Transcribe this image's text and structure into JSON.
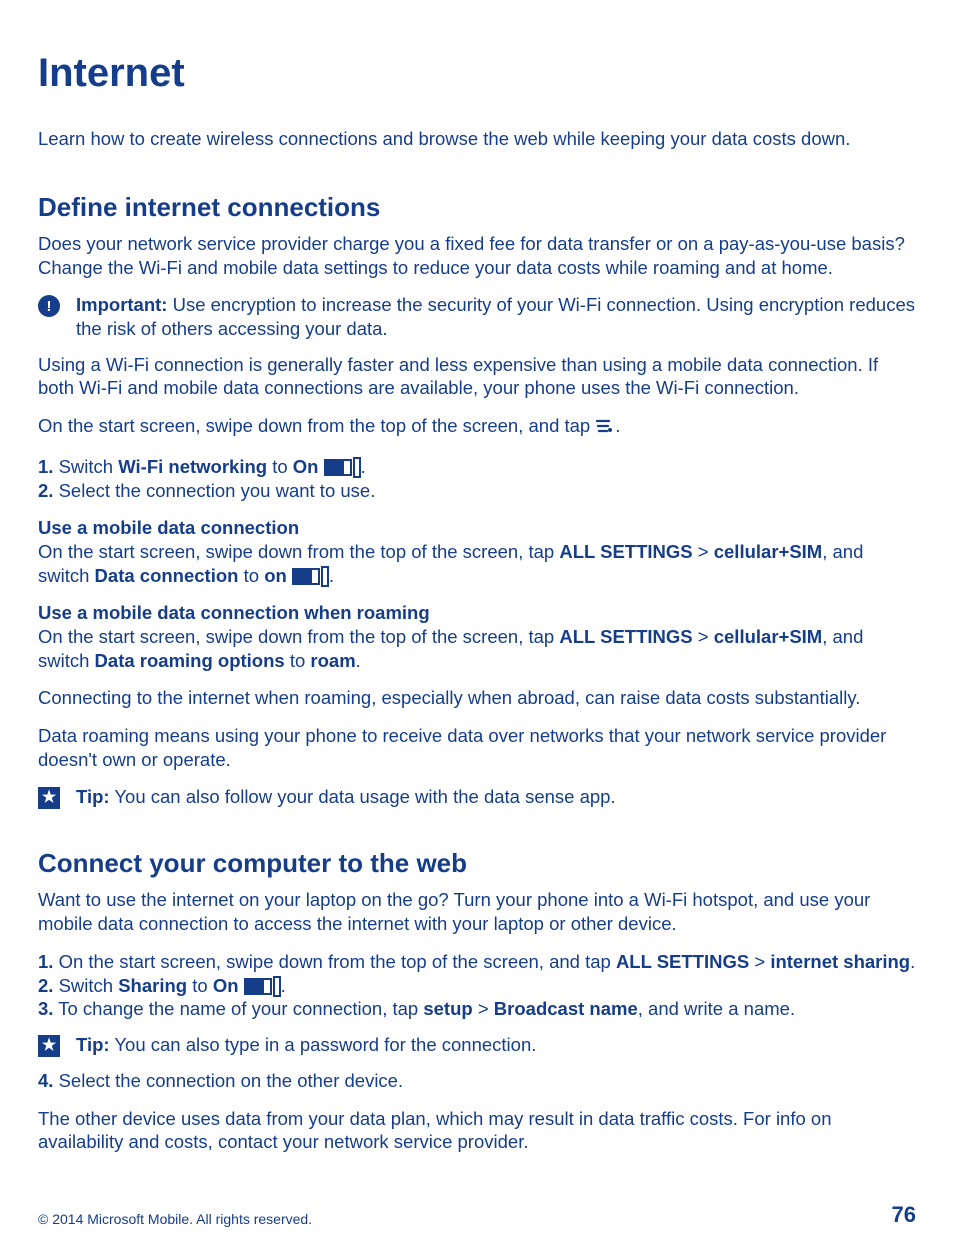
{
  "title": "Internet",
  "intro": "Learn how to create wireless connections and browse the web while keeping your data costs down.",
  "sec1": {
    "heading": "Define internet connections",
    "p1": "Does your network service provider charge you a fixed fee for data transfer or on a pay-as-you-use basis? Change the Wi-Fi and mobile data settings to reduce your data costs while roaming and at home.",
    "important_label": "Important:",
    "important_text": " Use encryption to increase the security of your Wi-Fi connection. Using encryption reduces the risk of others accessing your data.",
    "p2": "Using a Wi-Fi connection is generally faster and less expensive than using a mobile data connection. If both Wi-Fi and mobile data connections are available, your phone uses the Wi-Fi connection.",
    "p3_a": "On the start screen, swipe down from the top of the screen, and tap ",
    "p3_b": ".",
    "step1_num": "1.",
    "step1_a": " Switch ",
    "step1_b": "Wi-Fi networking",
    "step1_c": " to ",
    "step1_d": "On",
    "step1_e": " ",
    "step1_f": ".",
    "step2_num": "2.",
    "step2_text": " Select the connection you want to use.",
    "sub1_heading": "Use a mobile data connection",
    "sub1_a": "On the start screen, swipe down from the top of the screen, tap ",
    "sub1_b": "ALL SETTINGS",
    "sub1_c": " > ",
    "sub1_d": "cellular+SIM",
    "sub1_e": ", and switch ",
    "sub1_f": "Data connection",
    "sub1_g": " to ",
    "sub1_h": "on",
    "sub1_i": " ",
    "sub1_j": ".",
    "sub2_heading": "Use a mobile data connection when roaming",
    "sub2_a": "On the start screen, swipe down from the top of the screen, tap ",
    "sub2_b": "ALL SETTINGS",
    "sub2_c": " > ",
    "sub2_d": "cellular+SIM",
    "sub2_e": ", and switch ",
    "sub2_f": "Data roaming options",
    "sub2_g": " to ",
    "sub2_h": "roam",
    "sub2_i": ".",
    "p4": "Connecting to the internet when roaming, especially when abroad, can raise data costs substantially.",
    "p5": "Data roaming means using your phone to receive data over networks that your network service provider doesn't own or operate.",
    "tip_label": "Tip:",
    "tip_text": " You can also follow your data usage with the data sense app."
  },
  "sec2": {
    "heading": "Connect your computer to the web",
    "p1": "Want to use the internet on your laptop on the go? Turn your phone into a Wi-Fi hotspot, and use your mobile data connection to access the internet with your laptop or other device.",
    "s1_num": "1.",
    "s1_a": " On the start screen, swipe down from the top of the screen, and tap ",
    "s1_b": "ALL SETTINGS",
    "s1_c": " > ",
    "s1_d": "internet sharing",
    "s1_e": ".",
    "s2_num": "2.",
    "s2_a": " Switch ",
    "s2_b": "Sharing",
    "s2_c": " to ",
    "s2_d": "On",
    "s2_e": " ",
    "s2_f": ".",
    "s3_num": "3.",
    "s3_a": " To change the name of your connection, tap ",
    "s3_b": "setup",
    "s3_c": " > ",
    "s3_d": "Broadcast name",
    "s3_e": ", and write a name.",
    "tip_label": "Tip:",
    "tip_text": " You can also type in a password for the connection.",
    "s4_num": "4.",
    "s4_text": " Select the connection on the other device.",
    "p2": "The other device uses data from your data plan, which may result in data traffic costs. For info on availability and costs, contact your network service provider."
  },
  "footer": {
    "copyright": "© 2014 Microsoft Mobile. All rights reserved.",
    "page": "76"
  }
}
